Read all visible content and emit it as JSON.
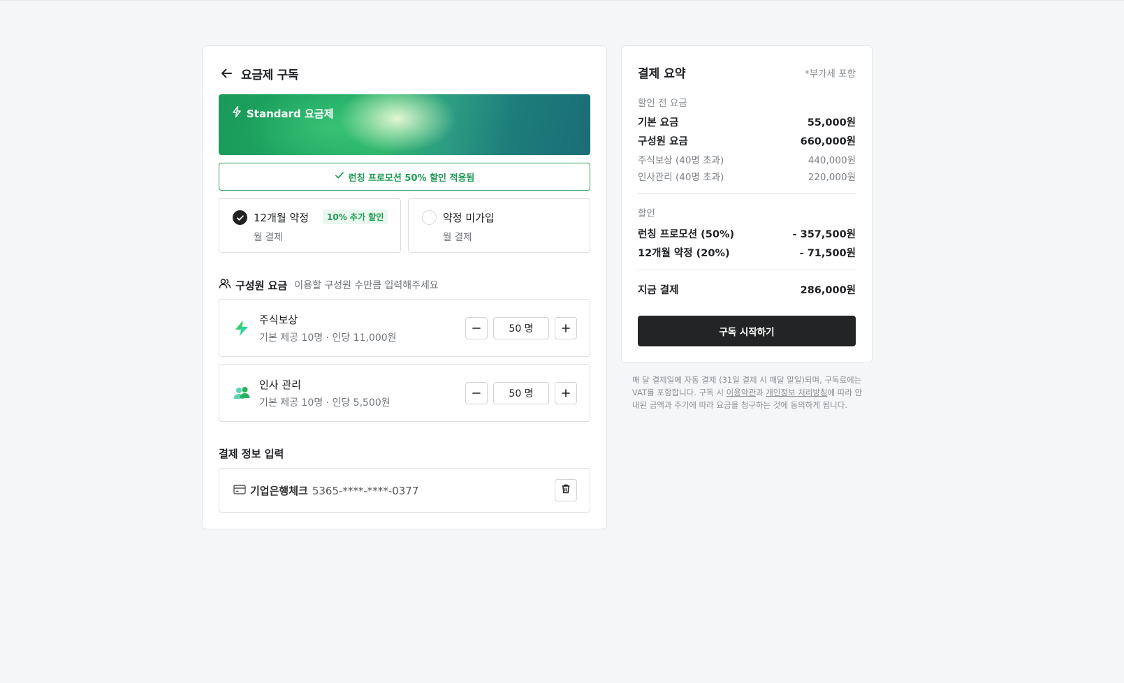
{
  "header": {
    "title": "요금제 구독",
    "back_icon": "arrow-left-icon"
  },
  "plan": {
    "name": "Standard 요금제",
    "icon": "lightning-icon"
  },
  "promo": {
    "text": "런칭 프로모션 50% 할인 적용됨",
    "color": "#1f9a55"
  },
  "contract_options": [
    {
      "title": "12개월 약정",
      "subtitle": "월 결제",
      "badge": "10% 추가 할인",
      "selected": true
    },
    {
      "title": "약정 미가입",
      "subtitle": "월 결제",
      "selected": false
    }
  ],
  "members": {
    "title": "구성원 요금",
    "hint": "이용할 구성원 수만큼 입력해주세요",
    "items": [
      {
        "name": "주식보상",
        "desc": "기본 제공 10명 · 인당 11,000원",
        "quantity": "50 명",
        "icon": "lightning-colored-icon"
      },
      {
        "name": "인사 관리",
        "desc": "기본 제공 10명 · 인당 5,500원",
        "quantity": "50 명",
        "icon": "people-icon"
      }
    ]
  },
  "payment": {
    "title": "결제 정보 입력",
    "card_bank": "기업은행체크",
    "card_number": "5365-****-****-0377"
  },
  "summary": {
    "title": "결제 요약",
    "vat_note": "*부가세 포함",
    "before_label": "할인 전 요금",
    "base_label": "기본 요금",
    "base_value": "55,000원",
    "member_label": "구성원 요금",
    "member_value": "660,000원",
    "stock_label": "주식보상 (40명 초과)",
    "stock_value": "440,000원",
    "hr_label": "인사관리 (40명 초과)",
    "hr_value": "220,000원",
    "discount_label": "할인",
    "promo_label": "런칭 프로모션 (50%)",
    "promo_value": "- 357,500원",
    "contract_label": "12개월 약정 (20%)",
    "contract_value": "- 71,500원",
    "total_label": "지금 결제",
    "total_value": "286,000원",
    "button": "구독 시작하기"
  },
  "legal": {
    "part1": "매 달 결제일에 자동 결제 (31일 결제 시 매달 말일)되며, 구독료에는 VAT를 포함합니다. 구독 시 ",
    "terms_link": "이용약관",
    "part2": "과 ",
    "privacy_link": "개인정보 처리방침",
    "part3": "에 따라 안내된 금액과 주기에 따라 요금을 청구하는 것에 동의하게 됩니다."
  }
}
